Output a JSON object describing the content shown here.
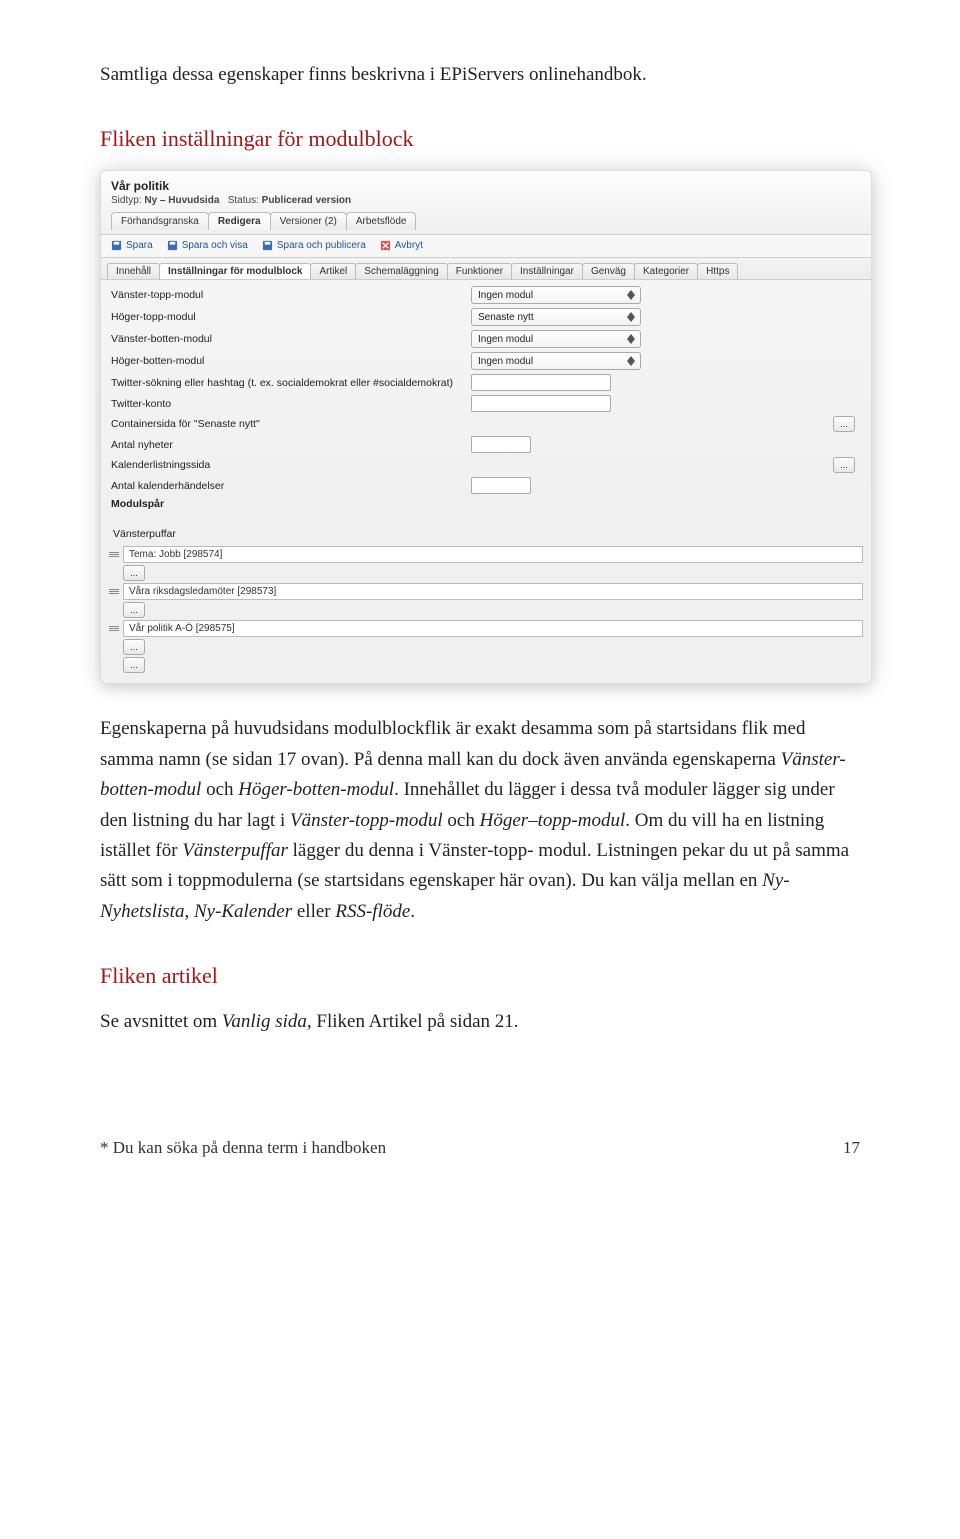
{
  "intro_line": "Samtliga dessa egenskaper finns beskrivna i EPiServers onlinehandbok.",
  "section1_title": "Fliken inställningar för modulblock",
  "panel": {
    "title": "Vår politik",
    "sid_label": "Sidtyp:",
    "sid_value": "Ny – Huvudsida",
    "status_label": "Status:",
    "status_value": "Publicerad version",
    "maintabs": [
      "Förhandsgranska",
      "Redigera",
      "Versioner (2)",
      "Arbetsflöde"
    ],
    "maintab_active": 1,
    "toolbar": [
      "Spara",
      "Spara och visa",
      "Spara och publicera",
      "Avbryt"
    ],
    "subtabs": [
      "Innehåll",
      "Inställningar för modulblock",
      "Artikel",
      "Schemaläggning",
      "Funktioner",
      "Inställningar",
      "Genväg",
      "Kategorier",
      "Https"
    ],
    "subtab_active": 1,
    "rows": [
      {
        "label": "Vänster-topp-modul",
        "ctrl": "select",
        "value": "Ingen modul"
      },
      {
        "label": "Höger-topp-modul",
        "ctrl": "select",
        "value": "Senaste nytt"
      },
      {
        "label": "Vänster-botten-modul",
        "ctrl": "select",
        "value": "Ingen modul"
      },
      {
        "label": "Höger-botten-modul",
        "ctrl": "select",
        "value": "Ingen modul"
      },
      {
        "label": "Twitter-sökning eller hashtag (t. ex. socialdemokrat eller #socialdemokrat)",
        "ctrl": "input",
        "size": "md"
      },
      {
        "label": "Twitter-konto",
        "ctrl": "input",
        "size": "md"
      },
      {
        "label": "Containersida för \"Senaste nytt\"",
        "ctrl": "dots"
      },
      {
        "label": "Antal nyheter",
        "ctrl": "input",
        "size": "sm"
      },
      {
        "label": "Kalenderlistningssida",
        "ctrl": "dots"
      },
      {
        "label": "Antal kalenderhändelser",
        "ctrl": "input",
        "size": "sm"
      },
      {
        "label": "Modulspår",
        "ctrl": "none",
        "bold": true
      }
    ],
    "puff_title": "Vänsterpuffar",
    "puff_items": [
      "Tema: Jobb [298574]",
      "Våra riksdagsledamöter [298573]",
      "Vår politik A-Ö [298575]"
    ]
  },
  "para1_a": "Egenskaperna på huvudsidans modulblockflik är exakt desamma som på startsidans flik med samma namn (se sidan 17 ovan). På denna mall kan du dock även använda egenskaperna ",
  "para1_i1": "Vänster-botten-modul",
  "para1_b": " och ",
  "para1_i2": "Höger-botten-modul",
  "para1_c": ". Innehållet du lägger i dessa två moduler lägger sig under den listning du har lagt i ",
  "para1_i3": "Vänster-topp-modul",
  "para1_d": " och ",
  "para1_i4": "Höger–topp-modul",
  "para1_e": ". Om du vill ha en listning istället för ",
  "para1_i5": "Vänsterpuffar",
  "para1_f": " lägger du denna i Vänster-topp- modul. Listningen pekar du ut på samma sätt som i toppmodulerna (se startsidans egenskaper här ovan). Du kan välja mellan en ",
  "para1_i6": "Ny-Nyhetslista",
  "para1_g": ", ",
  "para1_i7": "Ny-Kalender",
  "para1_h": " eller ",
  "para1_i8": "RSS-flöde",
  "para1_j": ".",
  "section2_title": "Fliken artikel",
  "para2_a": "Se avsnittet om ",
  "para2_i1": "Vanlig sida,",
  "para2_b": " Fliken Artikel på sidan 21.",
  "footer_left": "* Du kan söka på denna term i handboken",
  "footer_right": "17"
}
